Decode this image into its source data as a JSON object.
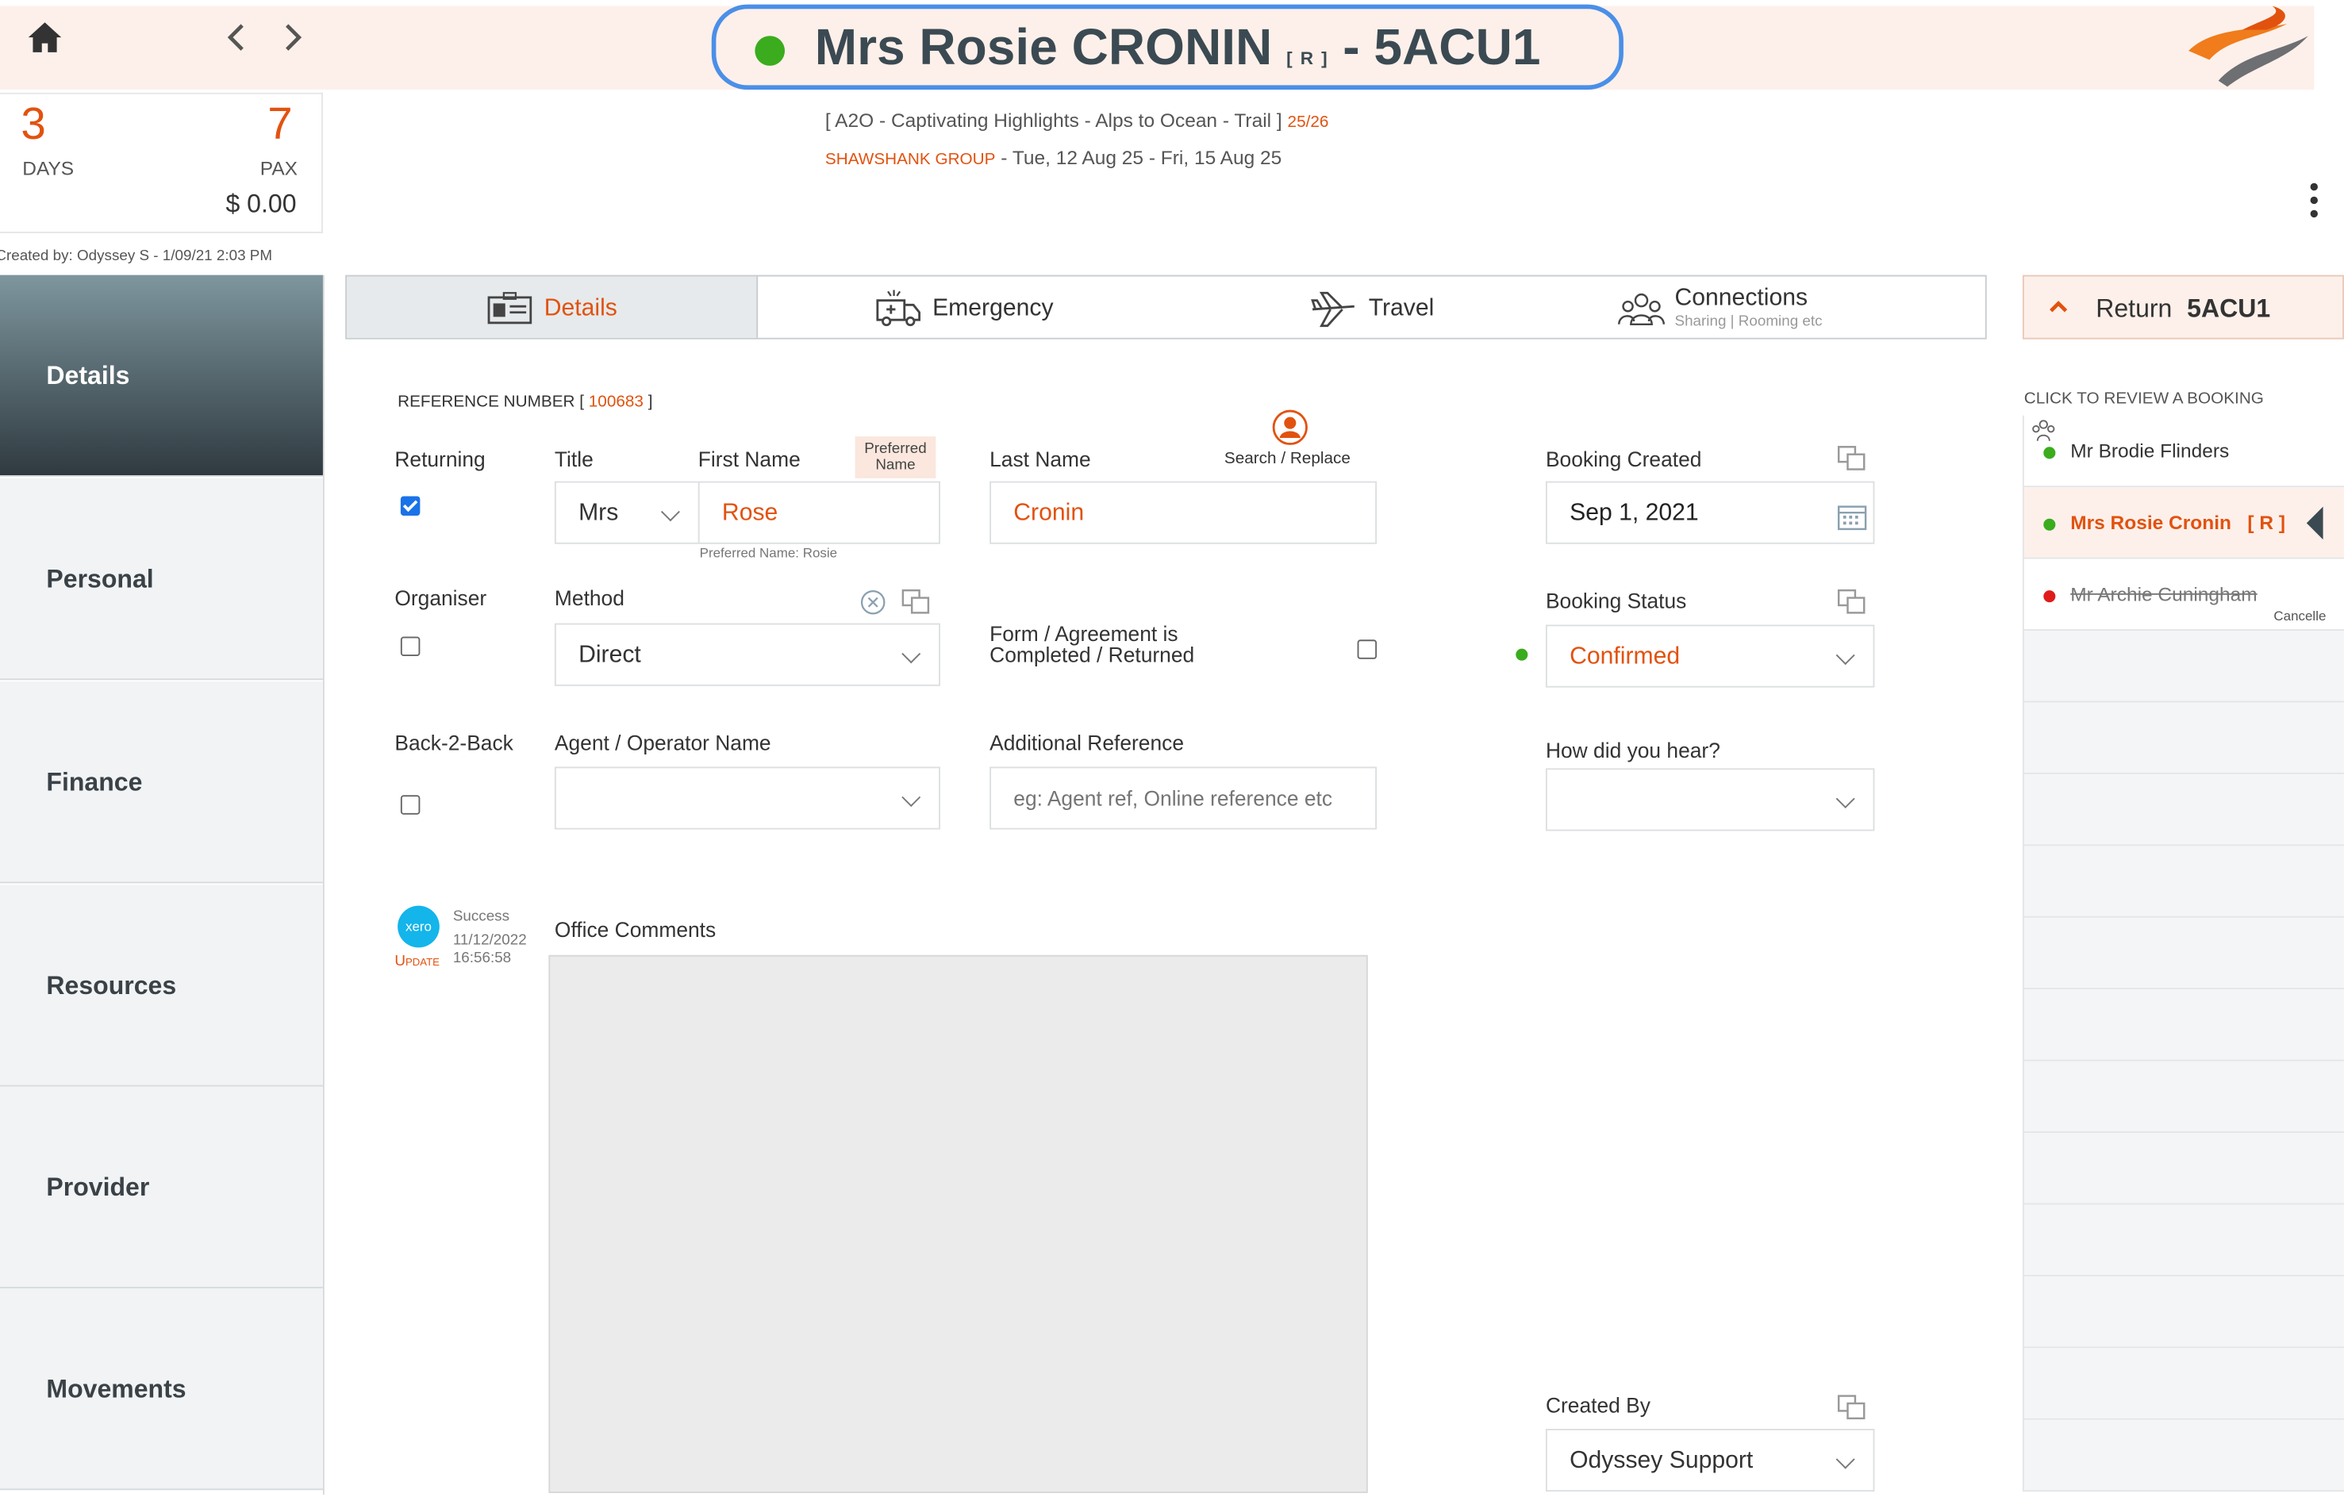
{
  "header": {
    "title_name": "Mrs Rosie CRONIN",
    "title_marker": "[ R ]",
    "title_code": "- 5ACU1",
    "status_color": "#3aac1e",
    "trip_name": "[ A2O - Captivating Highlights - Alps to Ocean - Trail ]",
    "trip_season": "25/26",
    "group_name": "SHAWSHANK GROUP",
    "dates": "- Tue, 12 Aug 25 - Fri, 15 Aug 25"
  },
  "summary": {
    "days_value": "3",
    "days_label": "DAYS",
    "pax_value": "7",
    "pax_label": "PAX",
    "amount": "$ 0.00",
    "created_by": "Created by: Odyssey S - 1/09/21 2:03 PM"
  },
  "sidenav": {
    "items": [
      {
        "label": "Details"
      },
      {
        "label": "Personal"
      },
      {
        "label": "Finance"
      },
      {
        "label": "Resources"
      },
      {
        "label": "Provider"
      },
      {
        "label": "Movements"
      }
    ]
  },
  "tabs": {
    "details": "Details",
    "emergency": "Emergency",
    "travel": "Travel",
    "connections": "Connections",
    "connections_sub": "Sharing | Rooming etc"
  },
  "form": {
    "reference_label": "REFERENCE NUMBER [",
    "reference_number": "100683",
    "reference_close": "]",
    "returning_label": "Returning",
    "returning_checked": true,
    "title_label": "Title",
    "title_value": "Mrs",
    "first_name_label": "First Name",
    "first_name_value": "Rose",
    "preferred_name_tag": "Preferred Name",
    "preferred_name_note": "Preferred Name: Rosie",
    "last_name_label": "Last Name",
    "last_name_value": "Cronin",
    "search_replace_label": "Search / Replace",
    "booking_created_label": "Booking Created",
    "booking_created_value": "Sep 1, 2021",
    "organiser_label": "Organiser",
    "method_label": "Method",
    "method_value": "Direct",
    "form_agreement_label": "Form / Agreement is Completed / Returned",
    "booking_status_label": "Booking Status",
    "booking_status_value": "Confirmed",
    "back2back_label": "Back-2-Back",
    "agent_label": "Agent / Operator Name",
    "agent_value": "",
    "additional_ref_label": "Additional Reference",
    "additional_ref_placeholder": "eg: Agent ref, Online reference etc",
    "how_hear_label": "How did you hear?",
    "how_hear_value": "",
    "xero_logo": "xero",
    "xero_status": "Success",
    "xero_date": "11/12/2022",
    "xero_time": "16:56:58",
    "xero_update": "Update",
    "office_comments_label": "Office Comments",
    "created_by_label": "Created By",
    "created_by_value": "Odyssey Support"
  },
  "right_panel": {
    "return_label": "Return",
    "return_code": "5ACU1",
    "review_label": "CLICK TO REVIEW A BOOKING",
    "bookings": [
      {
        "name": "Mr Brodie Flinders",
        "dot": "#3aac1e"
      },
      {
        "name": "Mrs Rosie Cronin   [ R ]",
        "dot": "#3aac1e"
      },
      {
        "name": "Mr Archie Cuningham",
        "dot": "#e01b1b",
        "status": "Cancelle"
      }
    ]
  },
  "colors": {
    "accent": "#e2520f",
    "confirmed_dot": "#3aac1e",
    "cancelled_dot": "#e01b1b",
    "title_border": "#4a8fe8"
  }
}
